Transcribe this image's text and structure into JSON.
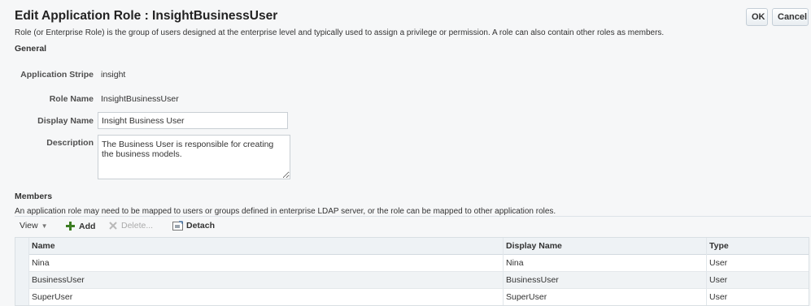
{
  "header": {
    "title": "Edit Application Role : InsightBusinessUser",
    "ok_label": "OK",
    "cancel_label": "Cancel",
    "description": "Role (or Enterprise Role) is the group of users designed at the enterprise level and typically used to assign a privilege or permission. A role can also contain other roles as members."
  },
  "general": {
    "heading": "General",
    "application_stripe_label": "Application Stripe",
    "application_stripe_value": "insight",
    "role_name_label": "Role Name",
    "role_name_value": "InsightBusinessUser",
    "display_name_label": "Display Name",
    "display_name_value": "Insight Business User",
    "description_label": "Description",
    "description_value": "The Business User is responsible for creating the business models."
  },
  "members": {
    "heading": "Members",
    "description": "An application role may need to be mapped to users or groups defined in enterprise LDAP server, or the role can be mapped to other application roles.",
    "toolbar": {
      "view_label": "View",
      "add_label": "Add",
      "delete_label": "Delete...",
      "detach_label": "Detach"
    },
    "columns": [
      "Name",
      "Display Name",
      "Type"
    ],
    "rows": [
      {
        "name": "Nina",
        "display_name": "Nina",
        "type": "User"
      },
      {
        "name": "BusinessUser",
        "display_name": "BusinessUser",
        "type": "User"
      },
      {
        "name": "SuperUser",
        "display_name": "SuperUser",
        "type": "User"
      }
    ]
  },
  "colors": {
    "accent_add": "#3c7d22",
    "disabled": "#aaaaaa",
    "selected_row": "#f0f3f5"
  },
  "icons": {
    "view": "triangle-down-icon",
    "add": "plus-icon",
    "delete": "x-icon",
    "detach": "detach-icon"
  }
}
